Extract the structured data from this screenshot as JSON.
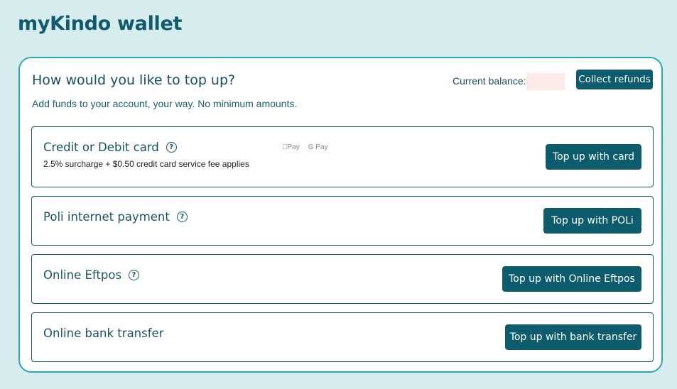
{
  "app": {
    "title": "myKindo wallet"
  },
  "panel": {
    "heading": "How would you like to top up?",
    "subtext": "Add funds to your account, your way. No minimum amounts.",
    "balance_label": "Current balance:",
    "collect_refunds_label": "Collect refunds"
  },
  "options": [
    {
      "title": "Credit or Debit card",
      "help_icon": "?",
      "note": "2.5% surcharge + $0.50 credit card service fee applies",
      "wallets": [
        "Pay",
        "G Pay"
      ],
      "button_label": "Top up with card"
    },
    {
      "title": "Poli internet payment",
      "help_icon": "?",
      "button_label": "Top up with POLi"
    },
    {
      "title": "Online Eftpos",
      "help_icon": "?",
      "button_label": "Top up with Online Eftpos"
    },
    {
      "title": "Online bank transfer",
      "button_label": "Top up with bank transfer"
    }
  ],
  "colors": {
    "background": "#d6ecee",
    "accent": "#0d5c6e",
    "panel_border": "#2aa7b5",
    "balance_redacted": "#fde9e6"
  }
}
